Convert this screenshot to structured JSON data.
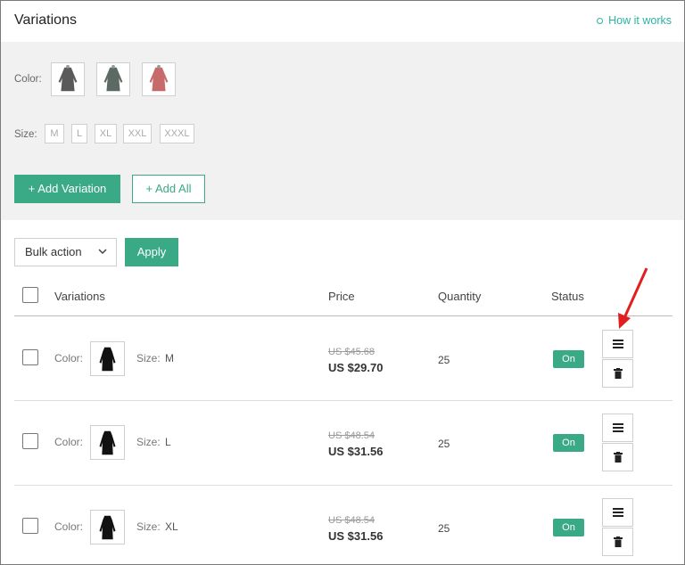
{
  "header": {
    "title": "Variations",
    "help_link": "How it works"
  },
  "attributes": {
    "color_label": "Color:",
    "colors": [
      {
        "name": "dark gray",
        "hex": "#5a5a5a"
      },
      {
        "name": "dark green-gray",
        "hex": "#5b6b63"
      },
      {
        "name": "rose red",
        "hex": "#c76a6a"
      }
    ],
    "size_label": "Size:",
    "sizes": [
      "M",
      "L",
      "XL",
      "XXL",
      "XXXL"
    ]
  },
  "actions": {
    "add_variation": "+ Add Variation",
    "add_all": "+ Add All",
    "bulk_action": "Bulk action",
    "apply": "Apply"
  },
  "table": {
    "headers": {
      "variations": "Variations",
      "price": "Price",
      "quantity": "Quantity",
      "status": "Status"
    },
    "rows": [
      {
        "color_label": "Color:",
        "size_label": "Size:",
        "size": "M",
        "old_price": "US $45.68",
        "price": "US $29.70",
        "quantity": "25",
        "status": "On"
      },
      {
        "color_label": "Color:",
        "size_label": "Size:",
        "size": "L",
        "old_price": "US $48.54",
        "price": "US $31.56",
        "quantity": "25",
        "status": "On"
      },
      {
        "color_label": "Color:",
        "size_label": "Size:",
        "size": "XL",
        "old_price": "US $48.54",
        "price": "US $31.56",
        "quantity": "25",
        "status": "On"
      }
    ]
  },
  "colors": {
    "accent": "#3aa985",
    "link": "#2bb3a0",
    "annotation_arrow": "#e02020",
    "panel_bg": "#f1f1f1"
  },
  "icons": {
    "menu": "menu-icon",
    "delete": "trash-icon",
    "help": "circle-icon",
    "dropdown": "chevron-down-icon"
  }
}
